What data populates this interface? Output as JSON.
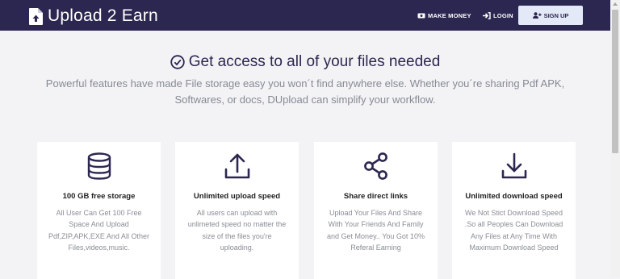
{
  "navbar": {
    "brand": "Upload 2 Earn",
    "make_money": "MAKE MONEY",
    "login": "LOGIN",
    "signup": "SIGN UP"
  },
  "hero": {
    "title": "Get access to all of your files needed",
    "subtitle": "Powerful features have made File storage easy you won´t find anywhere else. Whether you´re sharing Pdf APK, Softwares, or docs, DUpload can simplify your workflow."
  },
  "features": [
    {
      "icon": "database-icon",
      "title": "100 GB free storage",
      "description": "All User Can Get 100 Free Space And Upload Pdf,ZIP,APK,EXE And All Other Files,videos,music."
    },
    {
      "icon": "upload-icon",
      "title": "Unlimited upload speed",
      "description": "All users can upload with unlimeted speed no matter the size of the files you're uploading."
    },
    {
      "icon": "share-icon",
      "title": "Share direct links",
      "description": "Upload Your Files And Share With Your Friends And Family and Get Money.. You Got 10% Referal Earning"
    },
    {
      "icon": "download-icon",
      "title": "Unlimited download speed",
      "description": "We Not Stict Download Speed .So all Peoples Can Download Any Files at Any Time With Maximum Download Speed"
    }
  ],
  "colors": {
    "navbar": "#2c2750",
    "accent": "#2c2750",
    "signup_bg": "#e3e9f6",
    "page_bg": "#f3f3f5",
    "muted_text": "#868a94"
  }
}
